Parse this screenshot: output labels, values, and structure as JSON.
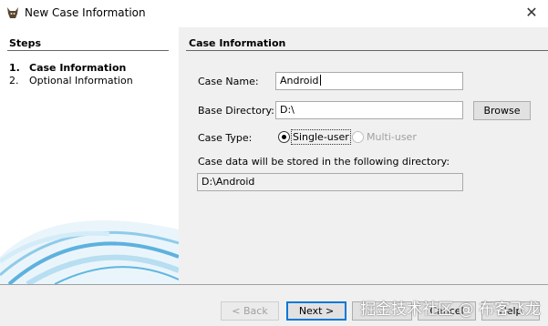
{
  "window": {
    "title": "New Case Information",
    "close_glyph": "✕"
  },
  "steps": {
    "title": "Steps",
    "items": [
      {
        "num": "1.",
        "label": "Case Information"
      },
      {
        "num": "2.",
        "label": "Optional Information"
      }
    ]
  },
  "case_info": {
    "title": "Case Information",
    "case_name_label": "Case Name:",
    "case_name_value": "Android",
    "base_dir_label": "Base Directory:",
    "base_dir_value": "D:\\",
    "browse_label": "Browse",
    "case_type_label": "Case Type:",
    "single_user_label": "Single-user",
    "multi_user_label": "Multi-user",
    "storage_note": "Case data will be stored in the following directory:",
    "storage_path": "D:\\Android"
  },
  "buttons": {
    "back": "< Back",
    "next": "Next >",
    "cancel": "Cancel",
    "help": "Help"
  },
  "watermark": "掘金技术社区 @ 布客飞龙",
  "colors": {
    "panel_bg": "#f0f0f0",
    "accent": "#0078d7",
    "swoosh": "#3aa0d8"
  }
}
